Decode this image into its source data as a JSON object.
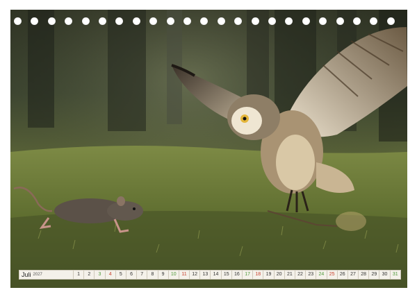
{
  "calendar": {
    "month": "Juli",
    "year": "2027",
    "days": [
      {
        "n": "1",
        "kind": "weekday"
      },
      {
        "n": "2",
        "kind": "weekday"
      },
      {
        "n": "3",
        "kind": "sat"
      },
      {
        "n": "4",
        "kind": "sun"
      },
      {
        "n": "5",
        "kind": "weekday"
      },
      {
        "n": "6",
        "kind": "weekday"
      },
      {
        "n": "7",
        "kind": "weekday"
      },
      {
        "n": "8",
        "kind": "weekday"
      },
      {
        "n": "9",
        "kind": "weekday"
      },
      {
        "n": "10",
        "kind": "sat"
      },
      {
        "n": "11",
        "kind": "sun"
      },
      {
        "n": "12",
        "kind": "weekday"
      },
      {
        "n": "13",
        "kind": "weekday"
      },
      {
        "n": "14",
        "kind": "weekday"
      },
      {
        "n": "15",
        "kind": "weekday"
      },
      {
        "n": "16",
        "kind": "weekday"
      },
      {
        "n": "17",
        "kind": "sat"
      },
      {
        "n": "18",
        "kind": "sun"
      },
      {
        "n": "19",
        "kind": "weekday"
      },
      {
        "n": "20",
        "kind": "weekday"
      },
      {
        "n": "21",
        "kind": "weekday"
      },
      {
        "n": "22",
        "kind": "weekday"
      },
      {
        "n": "23",
        "kind": "weekday"
      },
      {
        "n": "24",
        "kind": "sat"
      },
      {
        "n": "25",
        "kind": "sun"
      },
      {
        "n": "26",
        "kind": "weekday"
      },
      {
        "n": "27",
        "kind": "weekday"
      },
      {
        "n": "28",
        "kind": "weekday"
      },
      {
        "n": "29",
        "kind": "weekday"
      },
      {
        "n": "30",
        "kind": "weekday"
      },
      {
        "n": "31",
        "kind": "sat"
      }
    ]
  },
  "colors": {
    "saturday": "#4f9a3a",
    "sunday": "#c8412e",
    "strip_bg": "#f4f1ea"
  },
  "photo": {
    "subjects": [
      "owl-in-flight",
      "running-rat"
    ]
  }
}
